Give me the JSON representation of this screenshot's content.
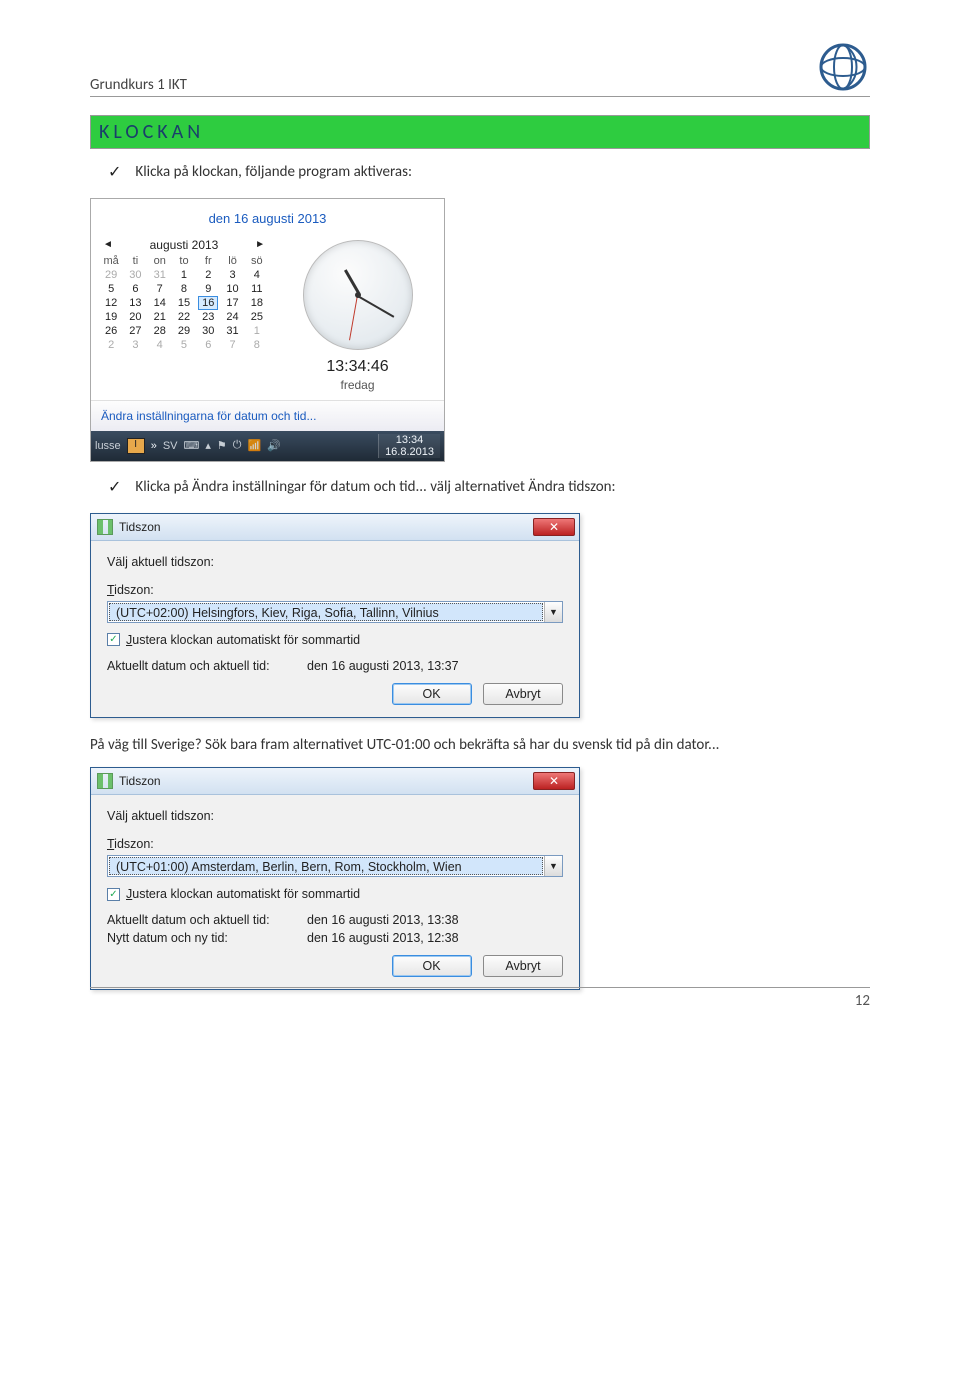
{
  "header": {
    "title": "Grundkurs 1 IKT"
  },
  "section": {
    "heading": "KLOCKAN"
  },
  "bullets": {
    "b1": "Klicka på klockan, följande program aktiveras:",
    "b2": "Klicka på Ändra inställningar för datum och tid... välj alternativet Ändra tidszon:"
  },
  "clock": {
    "dateline": "den 16 augusti 2013",
    "month": "augusti 2013",
    "dows": [
      "må",
      "ti",
      "on",
      "to",
      "fr",
      "lö",
      "sö"
    ],
    "weeks": [
      [
        {
          "d": "29",
          "oth": true
        },
        {
          "d": "30",
          "oth": true
        },
        {
          "d": "31",
          "oth": true
        },
        {
          "d": "1"
        },
        {
          "d": "2"
        },
        {
          "d": "3"
        },
        {
          "d": "4"
        }
      ],
      [
        {
          "d": "5"
        },
        {
          "d": "6"
        },
        {
          "d": "7"
        },
        {
          "d": "8"
        },
        {
          "d": "9"
        },
        {
          "d": "10"
        },
        {
          "d": "11"
        }
      ],
      [
        {
          "d": "12"
        },
        {
          "d": "13"
        },
        {
          "d": "14"
        },
        {
          "d": "15"
        },
        {
          "d": "16",
          "today": true
        },
        {
          "d": "17"
        },
        {
          "d": "18"
        }
      ],
      [
        {
          "d": "19"
        },
        {
          "d": "20"
        },
        {
          "d": "21"
        },
        {
          "d": "22"
        },
        {
          "d": "23"
        },
        {
          "d": "24"
        },
        {
          "d": "25"
        }
      ],
      [
        {
          "d": "26"
        },
        {
          "d": "27"
        },
        {
          "d": "28"
        },
        {
          "d": "29"
        },
        {
          "d": "30"
        },
        {
          "d": "31"
        },
        {
          "d": "1",
          "oth": true
        }
      ],
      [
        {
          "d": "2",
          "oth": true
        },
        {
          "d": "3",
          "oth": true
        },
        {
          "d": "4",
          "oth": true
        },
        {
          "d": "5",
          "oth": true
        },
        {
          "d": "6",
          "oth": true
        },
        {
          "d": "7",
          "oth": true
        },
        {
          "d": "8",
          "oth": true
        }
      ]
    ],
    "time": "13:34:46",
    "day": "fredag",
    "link": "Ändra inställningarna för datum och tid...",
    "taskbar": {
      "left": "lusse",
      "btn": "I",
      "lang": "SV",
      "time": "13:34",
      "date": "16.8.2013"
    }
  },
  "tz1": {
    "title": "Tidszon",
    "prompt": "Välj aktuell tidszon:",
    "label": "Tidszon:",
    "label_u": "T",
    "value": "(UTC+02:00) Helsingfors, Kiev, Riga, Sofia, Tallinn, Vilnius",
    "chk": "Justera klockan automatiskt för sommartid",
    "chk_u": "J",
    "row1k": "Aktuellt datum och aktuell tid:",
    "row1v": "den 16 augusti 2013, 13:37",
    "ok": "OK",
    "cancel": "Avbryt"
  },
  "para1": "På väg till Sverige? Sök bara fram alternativet UTC-01:00 och bekräfta så har du svensk tid på din dator...",
  "tz2": {
    "title": "Tidszon",
    "prompt": "Välj aktuell tidszon:",
    "label": "Tidszon:",
    "label_u": "T",
    "value": "(UTC+01:00) Amsterdam, Berlin, Bern, Rom, Stockholm, Wien",
    "chk": "Justera klockan automatiskt för sommartid",
    "chk_u": "J",
    "row1k": "Aktuellt datum och aktuell tid:",
    "row1v": "den 16 augusti 2013, 13:38",
    "row2k": "Nytt datum och ny tid:",
    "row2v": "den 16 augusti 2013, 12:38",
    "ok": "OK",
    "cancel": "Avbryt"
  },
  "page_number": "12"
}
